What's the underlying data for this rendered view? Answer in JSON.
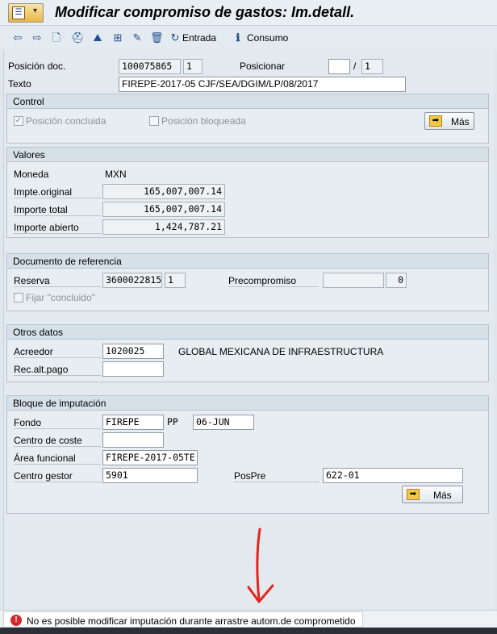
{
  "window": {
    "title": "Modificar compromiso de gastos: Im.detall."
  },
  "toolbar": {
    "entrada_label": "Entrada",
    "consumo_label": "Consumo"
  },
  "header": {
    "posicion_doc_label": "Posición doc.",
    "posicion_doc_value": "100075865",
    "posicion_doc_item": "1",
    "posicionar_label": "Posicionar",
    "posicionar_value": "",
    "posicionar_sep": "/",
    "posicionar_total": "1",
    "texto_label": "Texto",
    "texto_value": "FIREPE-2017-05 CJF/SEA/DGIM/LP/08/2017"
  },
  "control": {
    "title": "Control",
    "posicion_concluida": "Posición concluida",
    "posicion_bloqueada": "Posición bloqueada",
    "mas_label": "Más"
  },
  "valores": {
    "title": "Valores",
    "moneda_label": "Moneda",
    "moneda_value": "MXN",
    "impte_original_label": "Impte.original",
    "impte_original_value": "165,007,007.14",
    "importe_total_label": "Importe total",
    "importe_total_value": "165,007,007.14",
    "importe_abierto_label": "Importe abierto",
    "importe_abierto_value": "1,424,787.21"
  },
  "referencia": {
    "title": "Documento de referencia",
    "reserva_label": "Reserva",
    "reserva_value": "3600022815",
    "reserva_item": "1",
    "precompromiso_label": "Precompromiso",
    "precompromiso_value": "",
    "precompromiso_item": "0",
    "fijar_label": "Fijar \"concluido\""
  },
  "otros": {
    "title": "Otros datos",
    "acreedor_label": "Acreedor",
    "acreedor_value": "1020025",
    "acreedor_name": "GLOBAL MEXICANA DE INFRAESTRUCTURA",
    "rec_alt_pago_label": "Rec.alt.pago",
    "rec_alt_pago_value": ""
  },
  "imputacion": {
    "title": "Bloque de imputación",
    "fondo_label": "Fondo",
    "fondo_value": "FIREPE",
    "pp_label": "PP",
    "pp_value": "06-JUN",
    "centro_coste_label": "Centro de coste",
    "centro_coste_value": "",
    "area_funcional_label": "Área funcional",
    "area_funcional_value": "FIREPE-2017-05TE",
    "centro_gestor_label": "Centro gestor",
    "centro_gestor_value": "5901",
    "pospre_label": "PosPre",
    "pospre_value": "622-01",
    "mas_label": "Más"
  },
  "status": {
    "message": "No es posible modificar imputación durante arrastre autom.de comprometido"
  },
  "colors": {
    "annotation_arrow": "#e3261d",
    "error": "#d42a2a"
  }
}
